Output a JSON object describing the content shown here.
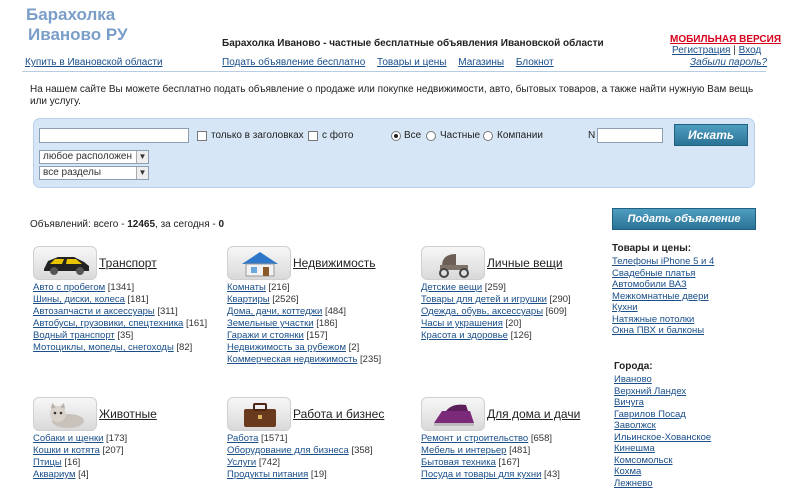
{
  "header": {
    "logo_line1": "Барахолка",
    "logo_line2": "Иваново РУ",
    "tagline": "Барахолка Иваново - частные бесплатные объявления Ивановской области",
    "mobile": "МОБИЛЬНАЯ ВЕРСИЯ",
    "register": "Регистрация",
    "sep": "|",
    "login": "Вход",
    "forgot": "Забыли пароль?",
    "buy_region": "Купить в Ивановской области",
    "nav": [
      "Подать объявление бесплатно",
      "Товары и цены",
      "Магазины",
      "Блокнот"
    ]
  },
  "intro": "На нашем сайте Вы можете бесплатно подать объявление о продаже или покупке недвижимости, авто, бытовых товаров, а также найти нужную Вам вещь или услугу.",
  "search": {
    "query": "",
    "only_titles": "только в заголовках",
    "with_photo": "с фото",
    "all": "Все",
    "private": "Частные",
    "companies": "Компании",
    "n_label": "N",
    "button": "Искать",
    "location": "любое расположен",
    "sections": "все разделы"
  },
  "stats": {
    "prefix": "Объявлений: всего - ",
    "total": "12465",
    "mid": ", за сегодня - ",
    "today": "0"
  },
  "categories": [
    {
      "title": "Транспорт",
      "icon": "car-icon",
      "items": [
        [
          "Авто с пробегом",
          "[1341]"
        ],
        [
          "Шины, диски, колеса",
          "[181]"
        ],
        [
          "Автозапчасти и аксессуары",
          "[311]"
        ],
        [
          "Автобусы, грузовики, спецтехника",
          "[161]"
        ],
        [
          "Водный транспорт",
          "[35]"
        ],
        [
          "Мотоциклы, мопеды, снегоходы",
          "[82]"
        ]
      ]
    },
    {
      "title": "Недвижимость",
      "icon": "house-icon",
      "items": [
        [
          "Комнаты",
          "[216]"
        ],
        [
          "Квартиры",
          "[2526]"
        ],
        [
          "Дома, дачи, коттеджи",
          "[484]"
        ],
        [
          "Земельные участки",
          "[186]"
        ],
        [
          "Гаражи и стоянки",
          "[157]"
        ],
        [
          "Недвижимость за рубежом",
          "[2]"
        ],
        [
          "Коммерческая недвижимость",
          "[235]"
        ]
      ]
    },
    {
      "title": "Личные вещи",
      "icon": "stroller-icon",
      "items": [
        [
          "Детские вещи",
          "[259]"
        ],
        [
          "Товары для детей и игрушки",
          "[290]"
        ],
        [
          "Одежда, обувь, аксессуары",
          "[609]"
        ],
        [
          "Часы и украшения",
          "[20]"
        ],
        [
          "Красота и здоровье",
          "[126]"
        ]
      ]
    },
    {
      "title": "Животные",
      "icon": "cat-icon",
      "items": [
        [
          "Собаки и щенки",
          "[173]"
        ],
        [
          "Кошки и котята",
          "[207]"
        ],
        [
          "Птицы",
          "[16]"
        ],
        [
          "Аквариум",
          "[4]"
        ]
      ]
    },
    {
      "title": "Работа и бизнес",
      "icon": "briefcase-icon",
      "items": [
        [
          "Работа",
          "[1571]"
        ],
        [
          "Оборудование для бизнеса",
          "[358]"
        ],
        [
          "Услуги",
          "[742]"
        ],
        [
          "Продукты питания",
          "[19]"
        ]
      ]
    },
    {
      "title": "Для дома и дачи",
      "icon": "iron-icon",
      "items": [
        [
          "Ремонт и строительство",
          "[658]"
        ],
        [
          "Мебель и интерьер",
          "[481]"
        ],
        [
          "Бытовая техника",
          "[167]"
        ],
        [
          "Посуда и товары для кухни",
          "[43]"
        ]
      ]
    }
  ],
  "sidebar": {
    "post_button": "Подать объявление",
    "goods_title": "Товары и цены:",
    "goods": [
      "Телефоны iPhone 5 и 4",
      "Свадебные платья",
      "Автомобили ВАЗ",
      "Межкомнатные двери",
      "Кухни",
      "Натяжные потолки",
      "Окна ПВХ и балконы"
    ],
    "cities_title": "Города:",
    "cities": [
      "Иваново",
      "Верхний Ландех",
      "Вичуга",
      "Гаврилов Посад",
      "Заволжск",
      "Ильинское-Хованское",
      "Кинешма",
      "Комсомольск",
      "Кохма",
      "Лежнево"
    ]
  },
  "colors": {
    "link": "#1a4f8a",
    "logo": "#7a9ec8",
    "mobile": "#d6001c",
    "panel": "#d6e6f6",
    "button": "#2a7396"
  }
}
